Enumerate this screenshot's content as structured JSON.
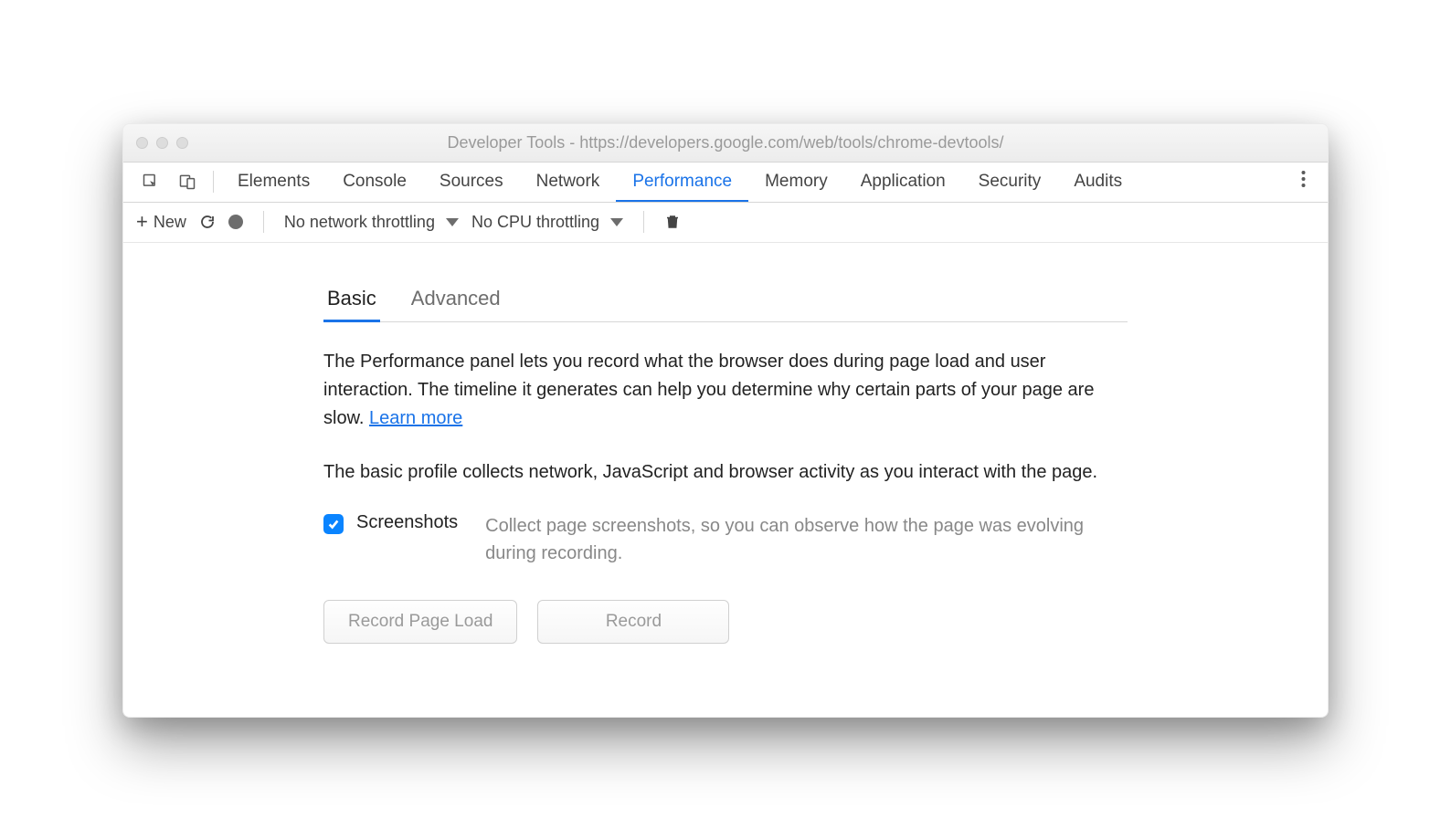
{
  "window": {
    "title": "Developer Tools - https://developers.google.com/web/tools/chrome-devtools/"
  },
  "tabs": [
    "Elements",
    "Console",
    "Sources",
    "Network",
    "Performance",
    "Memory",
    "Application",
    "Security",
    "Audits"
  ],
  "active_tab_index": 4,
  "toolbar": {
    "new_label": "New",
    "network_throttling": "No network throttling",
    "cpu_throttling": "No CPU throttling"
  },
  "subtabs": [
    "Basic",
    "Advanced"
  ],
  "active_subtab_index": 0,
  "intro_text": "The Performance panel lets you record what the browser does during page load and user interaction. The timeline it generates can help you determine why certain parts of your page are slow.  ",
  "learn_more": "Learn more",
  "basic_desc": "The basic profile collects network, JavaScript and browser activity as you interact with the page.",
  "option": {
    "label": "Screenshots",
    "desc": "Collect page screenshots, so you can observe how the page was evolving during recording.",
    "checked": true
  },
  "buttons": {
    "record_page_load": "Record Page Load",
    "record": "Record"
  }
}
